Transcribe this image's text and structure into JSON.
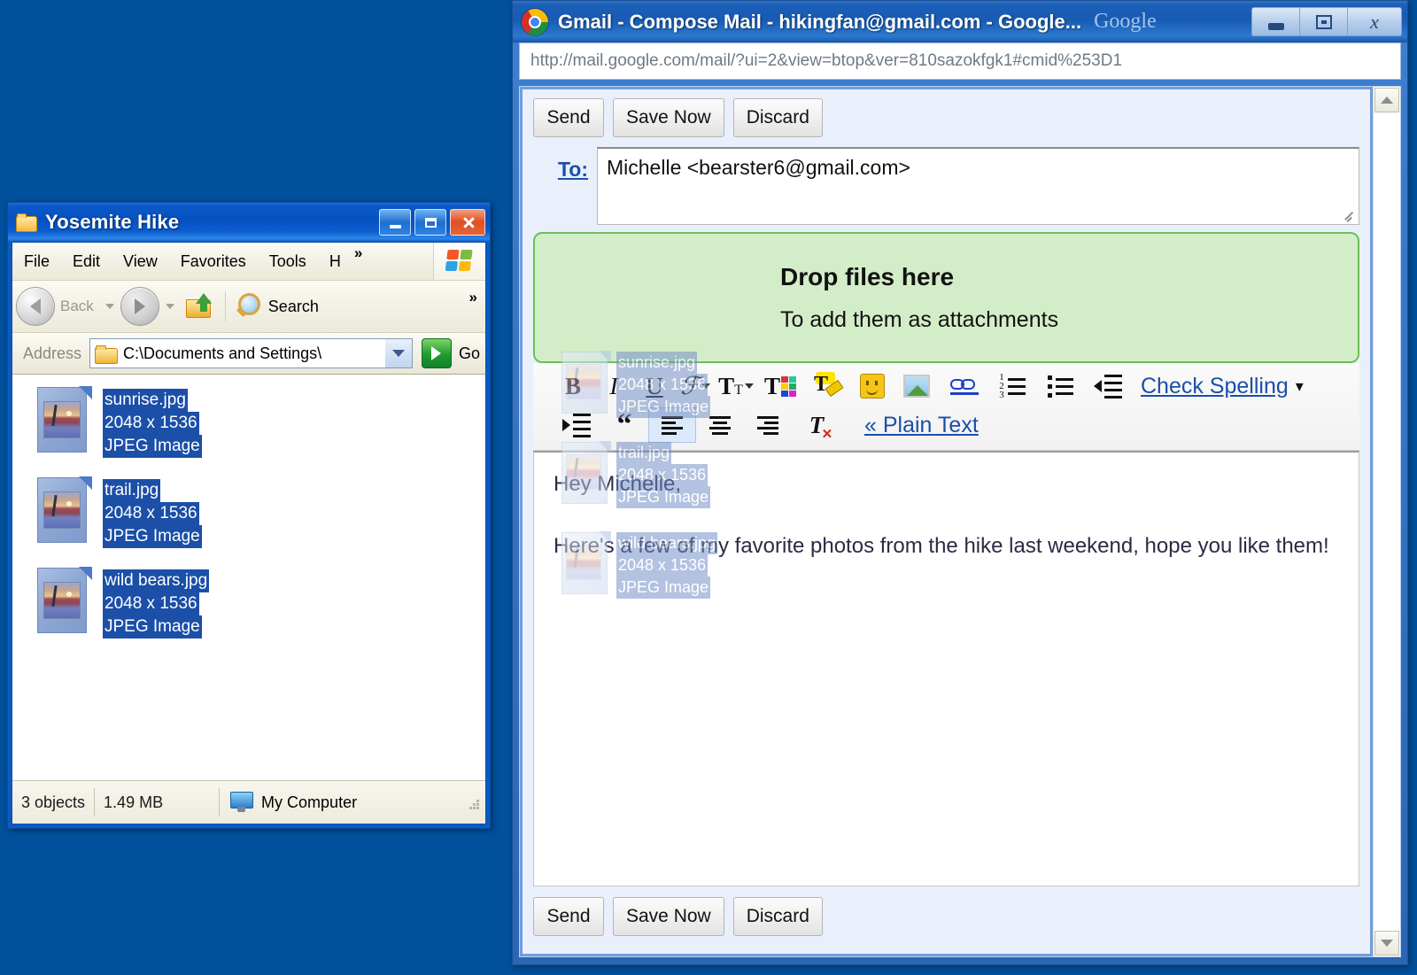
{
  "desktop": {
    "background_color": "#01509C"
  },
  "explorer": {
    "title": "Yosemite Hike",
    "title_icon": "folder-icon",
    "window_buttons": {
      "minimize": "minimize-icon",
      "maximize": "maximize-icon",
      "close": "close-icon"
    },
    "menu": [
      "File",
      "Edit",
      "View",
      "Favorites",
      "Tools",
      "H"
    ],
    "menu_overflow": "»",
    "toolbar": {
      "back_label": "Back",
      "search_label": "Search",
      "overflow": "»"
    },
    "address": {
      "label": "Address",
      "value": "C:\\Documents and Settings\\",
      "go_label": "Go"
    },
    "files": [
      {
        "name": "sunrise.jpg",
        "dimensions": "2048 x 1536",
        "type": "JPEG Image"
      },
      {
        "name": "trail.jpg",
        "dimensions": "2048 x 1536",
        "type": "JPEG Image"
      },
      {
        "name": "wild bears.jpg",
        "dimensions": "2048 x 1536",
        "type": "JPEG Image"
      }
    ],
    "status": {
      "object_count": "3 objects",
      "size": "1.49 MB",
      "location": "My Computer"
    }
  },
  "browser": {
    "title": "Gmail - Compose Mail - hikingfan@gmail.com - Google...",
    "watermark": "Google",
    "url": "http://mail.google.com/mail/?ui=2&view=btop&ver=810sazokfgk1#cmid%253D1",
    "window_buttons": {
      "minimize": "minimize-icon",
      "maximize": "maximize-icon",
      "close": "close-icon"
    }
  },
  "compose": {
    "top_buttons": [
      "Send",
      "Save Now",
      "Discard"
    ],
    "bottom_buttons": [
      "Send",
      "Save Now",
      "Discard"
    ],
    "to_label": "To:",
    "to_value": "Michelle <bearster6@gmail.com>",
    "dropzone": {
      "title": "Drop files here",
      "subtitle": "To add them as attachments",
      "background_color": "#D4EDC9",
      "border_color": "#6DBE5B"
    },
    "format_toolbar": {
      "row1": [
        "bold-icon",
        "italic-icon",
        "underline-icon",
        "font-family-icon",
        "font-size-icon",
        "text-color-icon",
        "highlight-icon",
        "emoji-icon",
        "insert-image-icon",
        "insert-link-icon",
        "numbered-list-icon",
        "bulleted-list-icon",
        "decrease-indent-icon"
      ],
      "check_spelling_label": "Check Spelling",
      "check_spelling_caret": "▾",
      "row2": [
        "increase-indent-icon",
        "quote-icon",
        "align-left-icon",
        "align-center-icon",
        "align-right-icon",
        "remove-formatting-icon"
      ],
      "plain_text_label": "« Plain Text"
    },
    "body": {
      "greeting": "Hey Michelle,",
      "paragraph": "Here's a few of my favorite photos from the hike last weekend, hope you like them!"
    }
  },
  "drag_ghost": {
    "files": [
      {
        "name": "sunrise.jpg",
        "dimensions": "2048 x 1536",
        "type": "JPEG Image"
      },
      {
        "name": "trail.jpg",
        "dimensions": "2048 x 1536",
        "type": "JPEG Image"
      },
      {
        "name": "wild bears.jpg",
        "dimensions": "2048 x 1536",
        "type": "JPEG Image"
      }
    ]
  }
}
